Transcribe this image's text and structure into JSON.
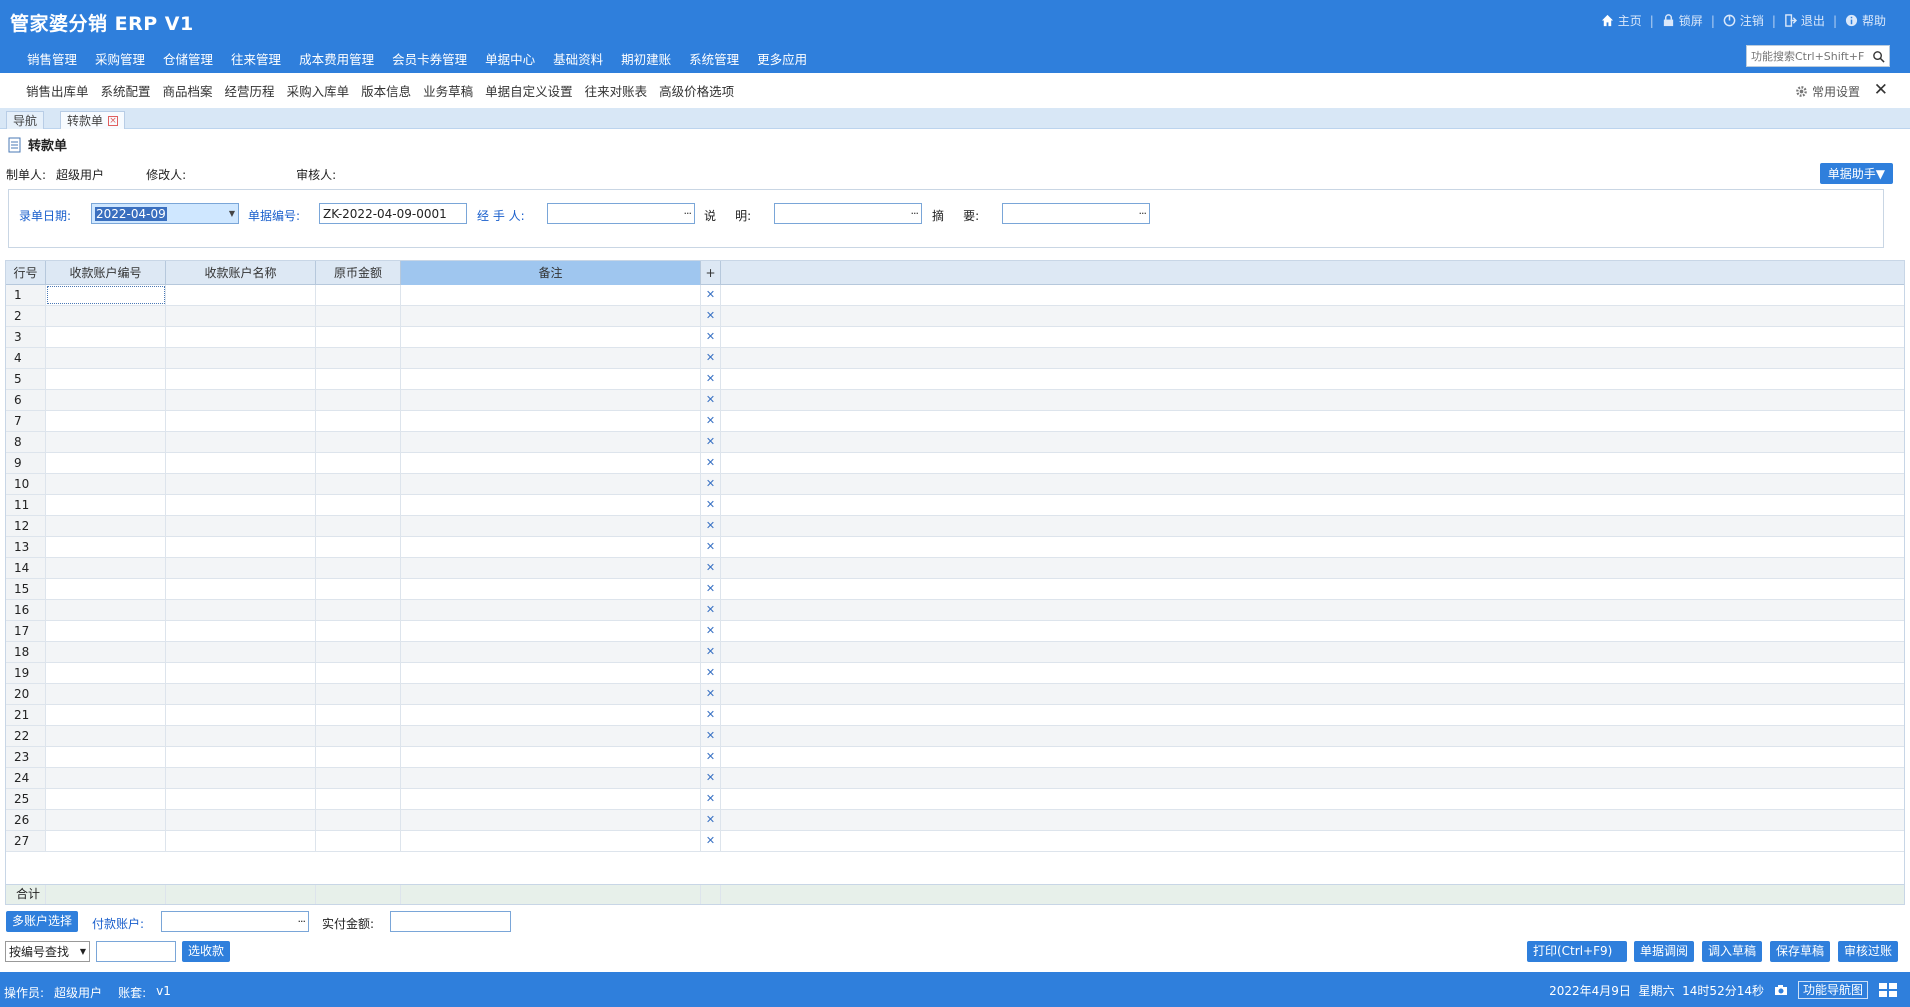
{
  "app": {
    "title": "管家婆分销 ERP V1",
    "brand_color": "#2f7fdc"
  },
  "top_links": [
    {
      "label": "主页",
      "icon": "home-icon"
    },
    {
      "label": "锁屏",
      "icon": "lock-icon"
    },
    {
      "label": "注销",
      "icon": "logout-circle-icon"
    },
    {
      "label": "退出",
      "icon": "exit-icon"
    },
    {
      "label": "帮助",
      "icon": "info-icon"
    }
  ],
  "main_nav": [
    "销售管理",
    "采购管理",
    "仓储管理",
    "往来管理",
    "成本费用管理",
    "会员卡券管理",
    "单据中心",
    "基础资料",
    "期初建账",
    "系统管理",
    "更多应用"
  ],
  "function_search": {
    "placeholder": "功能搜索Ctrl+Shift+F"
  },
  "quick_items": [
    "销售出库单",
    "系统配置",
    "商品档案",
    "经营历程",
    "采购入库单",
    "版本信息",
    "业务草稿",
    "单据自定义设置",
    "往来对账表",
    "高级价格选项"
  ],
  "common_settings": "常用设置",
  "tabs": [
    {
      "label": "导航"
    },
    {
      "label": "转款单",
      "active": true
    }
  ],
  "document": {
    "title": "转款单",
    "creator_label": "制单人:",
    "creator_value": "超级用户",
    "modifier_label": "修改人:",
    "reviewer_label": "审核人:",
    "helper_button": "单据助手▼"
  },
  "form": {
    "date_label": "录单日期:",
    "date_value": "2022-04-09",
    "docno_label": "单据编号:",
    "docno_value": "ZK-2022-04-09-0001",
    "handler_label": "经 手 人:",
    "desc_label": "说     明:",
    "summary_label": "摘     要:"
  },
  "grid": {
    "columns": [
      "行号",
      "收款账户编号",
      "收款账户名称",
      "原币金额",
      "备注"
    ],
    "add_symbol": "+",
    "row_count": 27,
    "total_label": "合计"
  },
  "bottom": {
    "multi_account_button": "多账户选择",
    "pay_account_label": "付款账户:",
    "actual_amount_label": "实付金额:",
    "query_select_value": "按编号查找",
    "select_button": "选收款",
    "actions": [
      "打印(Ctrl+F9)",
      "单据调阅",
      "调入草稿",
      "保存草稿",
      "审核过账"
    ]
  },
  "status": {
    "operator_label": "操作员:",
    "operator_value": "超级用户",
    "account_set_label": "账套:",
    "account_set_value": "v1",
    "datetime": "2022年4月9日  星期六  14时52分14秒",
    "nav_map": "功能导航图"
  }
}
